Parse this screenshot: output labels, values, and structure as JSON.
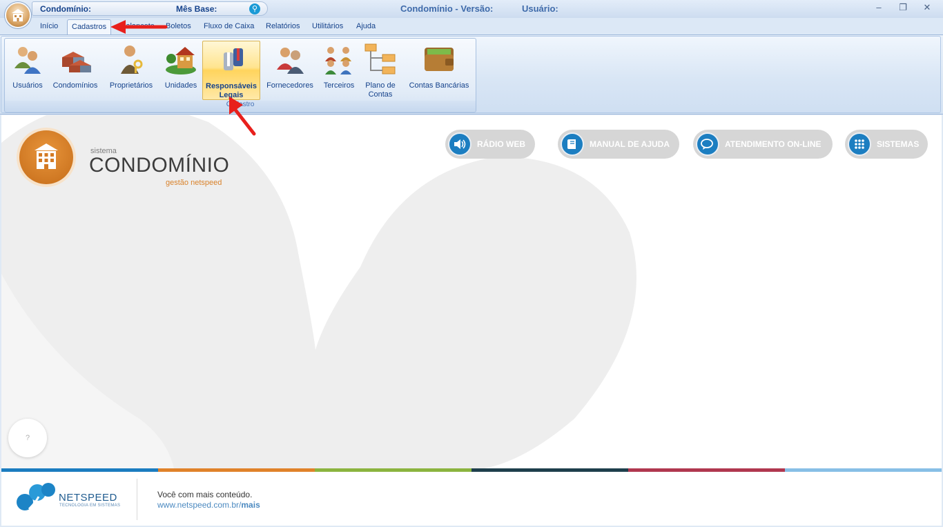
{
  "titlebar": {
    "condominio_label": "Condomínio:",
    "mes_base_label": "Mês Base:",
    "search_icon": "search-icon",
    "app_title": "Condomínio - Versão:",
    "usuario_label": "Usuário:",
    "minimize": "–",
    "restore": "❐",
    "close": "✕"
  },
  "tabs": [
    {
      "label": "Início"
    },
    {
      "label": "Cadastros",
      "active": true
    },
    {
      "label": "Balancete"
    },
    {
      "label": "Boletos"
    },
    {
      "label": "Fluxo de Caixa"
    },
    {
      "label": "Relatórios"
    },
    {
      "label": "Utilitários"
    },
    {
      "label": "Ajuda"
    }
  ],
  "ribbon": {
    "group_label": "Cadastro",
    "buttons": [
      {
        "label": "Usuários",
        "icon": "users-icon"
      },
      {
        "label": "Condomínios",
        "icon": "buildings-icon"
      },
      {
        "label": "Proprietários",
        "icon": "owner-key-icon"
      },
      {
        "label": "Unidades",
        "icon": "house-icon"
      },
      {
        "label": "Responsáveis Legais",
        "icon": "suits-icon",
        "highlighted": true
      },
      {
        "label": "Fornecedores",
        "icon": "suppliers-icon"
      },
      {
        "label": "Terceiros",
        "icon": "group-icon"
      },
      {
        "label": "Plano de Contas",
        "icon": "tree-chart-icon"
      },
      {
        "label": "Contas Bancárias",
        "icon": "wallet-icon"
      }
    ]
  },
  "brand": {
    "small": "sistema",
    "big": "CONDOMÍNIO",
    "sub": "gestão netspeed"
  },
  "actions": [
    {
      "label": "RÁDIO WEB",
      "icon": "speaker-icon"
    },
    {
      "label": "MANUAL DE AJUDA",
      "icon": "book-icon"
    },
    {
      "label": "ATENDIMENTO ON-LINE",
      "icon": "chat-icon"
    },
    {
      "label": "SISTEMAS",
      "icon": "grid-dots-icon"
    }
  ],
  "help": {
    "label": "?"
  },
  "footer": {
    "company": "NETSPEED",
    "tagline": "TECNOLOGIA EM SISTEMAS",
    "line1": "Você com mais conteúdo.",
    "link_prefix": "www.netspeed.com.br/",
    "link_bold": "mais",
    "stripe_colors": [
      "#1b7cc0",
      "#e0822a",
      "#8bb43f",
      "#1e3f4c",
      "#b0374f",
      "#87bfe6"
    ]
  },
  "colors": {
    "accent": "#1c7ec1",
    "brand_orange": "#d9822b",
    "ribbon_text": "#15428b",
    "annotation_arrow": "#e8201c"
  }
}
